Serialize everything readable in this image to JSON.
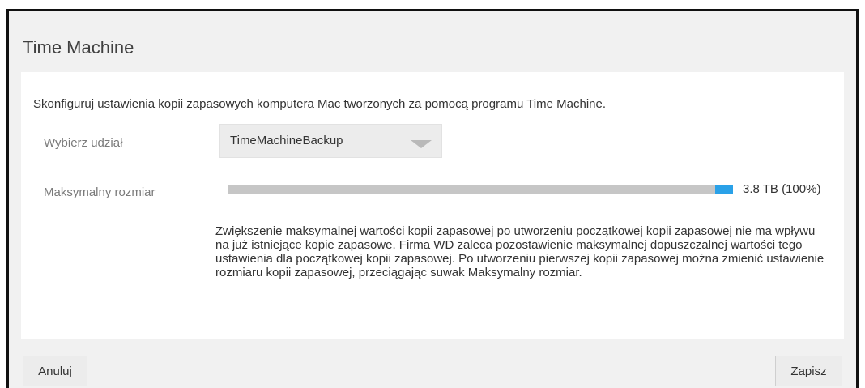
{
  "dialog": {
    "title": "Time Machine",
    "intro": "Skonfiguruj ustawienia kopii zapasowych komputera Mac tworzonych za pomocą programu Time Machine.",
    "share": {
      "label": "Wybierz udział",
      "selected": "TimeMachineBackup"
    },
    "size": {
      "label": "Maksymalny rozmiar",
      "value_text": "3.8 TB (100%)",
      "fraction": 1.0
    },
    "note": "Zwiększenie maksymalnej wartości kopii zapasowej po utworzeniu początkowej kopii zapasowej nie ma wpływu na już istniejące kopie zapasowe. Firma WD zaleca pozostawienie maksymalnej dopuszczalnej wartości tego ustawienia dla początkowej kopii zapasowej. Po utworzeniu pierwszej kopii zapasowej można zmienić ustawienie rozmiaru kopii zapasowej, przeciągając suwak Maksymalny rozmiar.",
    "buttons": {
      "cancel": "Anuluj",
      "save": "Zapisz"
    }
  },
  "colors": {
    "slider_handle": "#2aa1e8",
    "slider_track": "#c6c6c6",
    "dialog_background": "#f1f1f1"
  },
  "icons": {
    "dropdown": "chevron-down-icon"
  }
}
